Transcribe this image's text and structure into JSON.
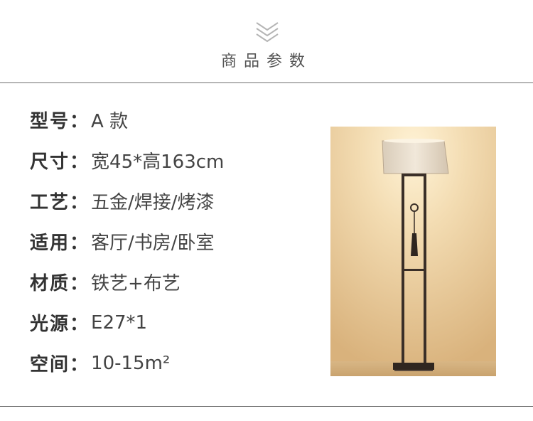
{
  "header": {
    "title": "商品参数",
    "chevron_icon": "double-chevron-down-icon"
  },
  "specs": [
    {
      "label": "型号",
      "value": "A 款"
    },
    {
      "label": "尺寸",
      "value": "宽45*高163cm"
    },
    {
      "label": "工艺",
      "value": "五金/焊接/烤漆"
    },
    {
      "label": "适用",
      "value": "客厅/书房/卧室"
    },
    {
      "label": "材质",
      "value": "铁艺+布艺"
    },
    {
      "label": "光源",
      "value": "E27*1"
    },
    {
      "label": "空间",
      "value": "10-15m²"
    }
  ],
  "separator": "：",
  "photo": {
    "subject": "floor-lamp",
    "colors": {
      "wall_light": "#f3dcb2",
      "wall_dark": "#d9b27c",
      "shade": "#e8dccb",
      "frame": "#3a2f28"
    }
  },
  "colors": {
    "rule": "#6f6f6f",
    "text": "#333333"
  }
}
